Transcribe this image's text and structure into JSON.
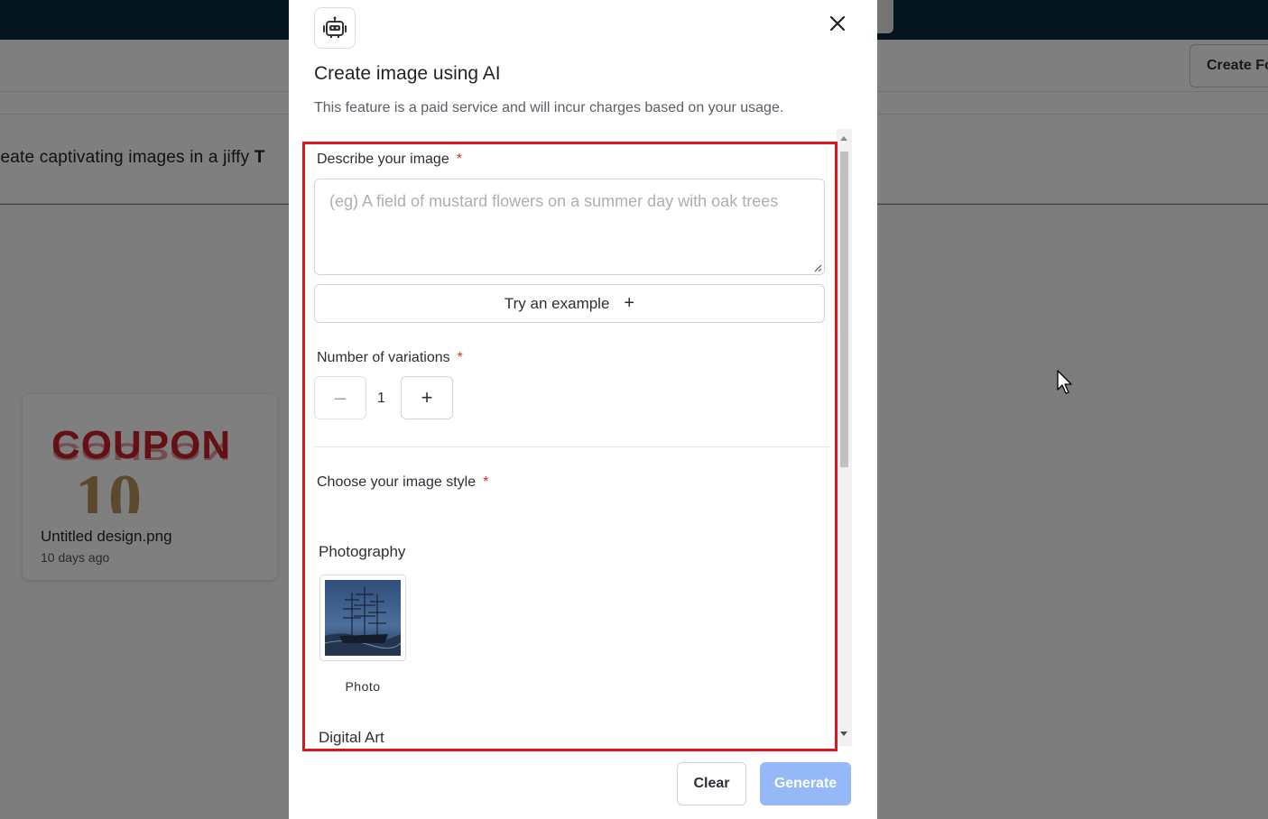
{
  "background": {
    "header_button_label": "Create Fo",
    "banner_text": "reate captivating images in a jiffy",
    "banner_bold": "T",
    "card": {
      "title": "Untitled design.png",
      "subtitle": "10 days ago",
      "thumb_word": "COUPON",
      "thumb_number": "10"
    }
  },
  "modal": {
    "icon": "robot-icon",
    "title": "Create image using AI",
    "description": "This feature is a paid service and will incur charges based on your usage.",
    "close_icon": "close-icon",
    "describe": {
      "label": "Describe your image",
      "required_mark": "*",
      "placeholder": "(eg) A field of mustard flowers on a summer day with oak trees",
      "value": ""
    },
    "try_example": {
      "label": "Try an example",
      "icon": "+"
    },
    "variations": {
      "label": "Number of variations",
      "required_mark": "*",
      "minus": "–",
      "plus": "+",
      "value": "1"
    },
    "style": {
      "label": "Choose your image style",
      "required_mark": "*",
      "groups": [
        {
          "name": "Photography",
          "options": [
            {
              "caption": "Photo"
            }
          ]
        },
        {
          "name": "Digital Art"
        }
      ]
    },
    "footer": {
      "clear_label": "Clear",
      "generate_label": "Generate"
    }
  },
  "colors": {
    "highlight": "#e0141c",
    "generate_disabled": "#94b8f8",
    "required": "#d32f2f",
    "topbar": "#0b2a3b"
  }
}
